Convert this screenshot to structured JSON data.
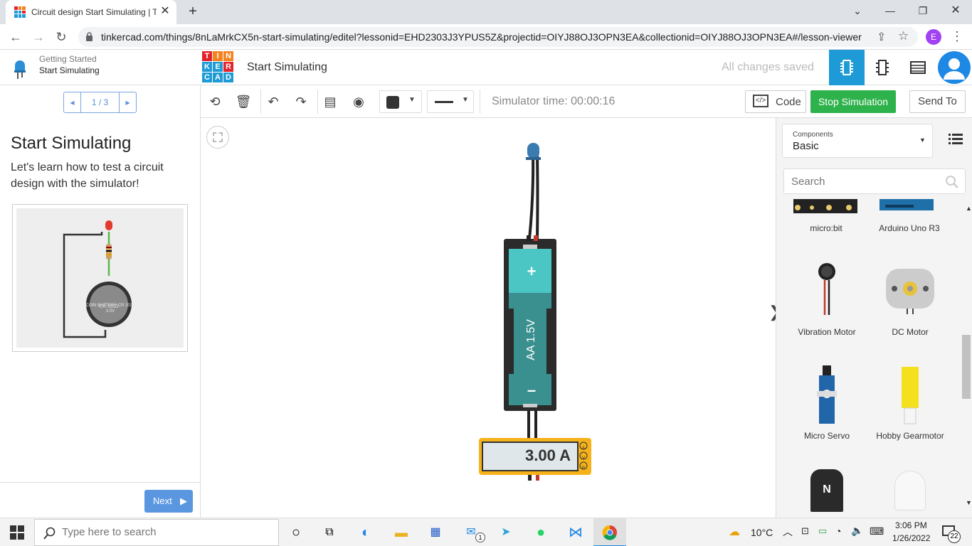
{
  "browser": {
    "tab_title": "Circuit design Start Simulating | T",
    "url": "tinkercad.com/things/8nLaMrkCX5n-start-simulating/editel?lessonid=EHD2303J3YPUS5Z&projectid=OIYJ88OJ3OPN3EA&collectionid=OIYJ88OJ3OPN3EA#/lesson-viewer",
    "profile_initial": "E"
  },
  "header": {
    "breadcrumb_parent": "Getting Started",
    "breadcrumb_current": "Start Simulating",
    "logo_letters": [
      "T",
      "I",
      "N",
      "K",
      "E",
      "R",
      "C",
      "A",
      "D"
    ],
    "logo_colors": [
      "#e2232a",
      "#f58220",
      "#f58220",
      "#1e9bd7",
      "#1e9bd7",
      "#e2232a",
      "#1e9bd7",
      "#1e9bd7",
      "#1e9bd7"
    ],
    "design_title": "Start Simulating",
    "save_status": "All changes saved"
  },
  "lesson": {
    "pager": "1 / 3",
    "title": "Start Simulating",
    "text": "Let's learn how to test a circuit design with the simulator!",
    "figure_battery_label": "COIN BATTERY CR 2032 3.0V",
    "next_label": "Next"
  },
  "toolbar": {
    "simulator_time": "Simulator time: 00:00:16",
    "code_label": "Code",
    "stop_label": "Stop Simulation",
    "send_label": "Send To"
  },
  "canvas": {
    "battery_label": "AA 1.5V",
    "battery_plus": "+",
    "battery_minus": "–",
    "meter_reading": "3.00 A",
    "meter_modes": [
      "A",
      "V",
      "R"
    ]
  },
  "components": {
    "dropdown_label": "Components",
    "dropdown_value": "Basic",
    "search_placeholder": "Search",
    "items": [
      "micro:bit",
      "Arduino Uno R3",
      "Vibration Motor",
      "DC Motor",
      "Micro Servo",
      "Hobby Gearmotor"
    ],
    "partial_item_letter": "N"
  },
  "taskbar": {
    "search_placeholder": "Type here to search",
    "weather": "10°C",
    "time": "3:06 PM",
    "date": "1/26/2022",
    "notification_count": "22",
    "mail_badge": "1"
  },
  "colors": {
    "accent": "#1e9bd7",
    "stop_green": "#2eb24b",
    "next_blue": "#5b97e0",
    "battery_teal": "#3a8f8f",
    "meter_yellow": "#f6b21b"
  }
}
